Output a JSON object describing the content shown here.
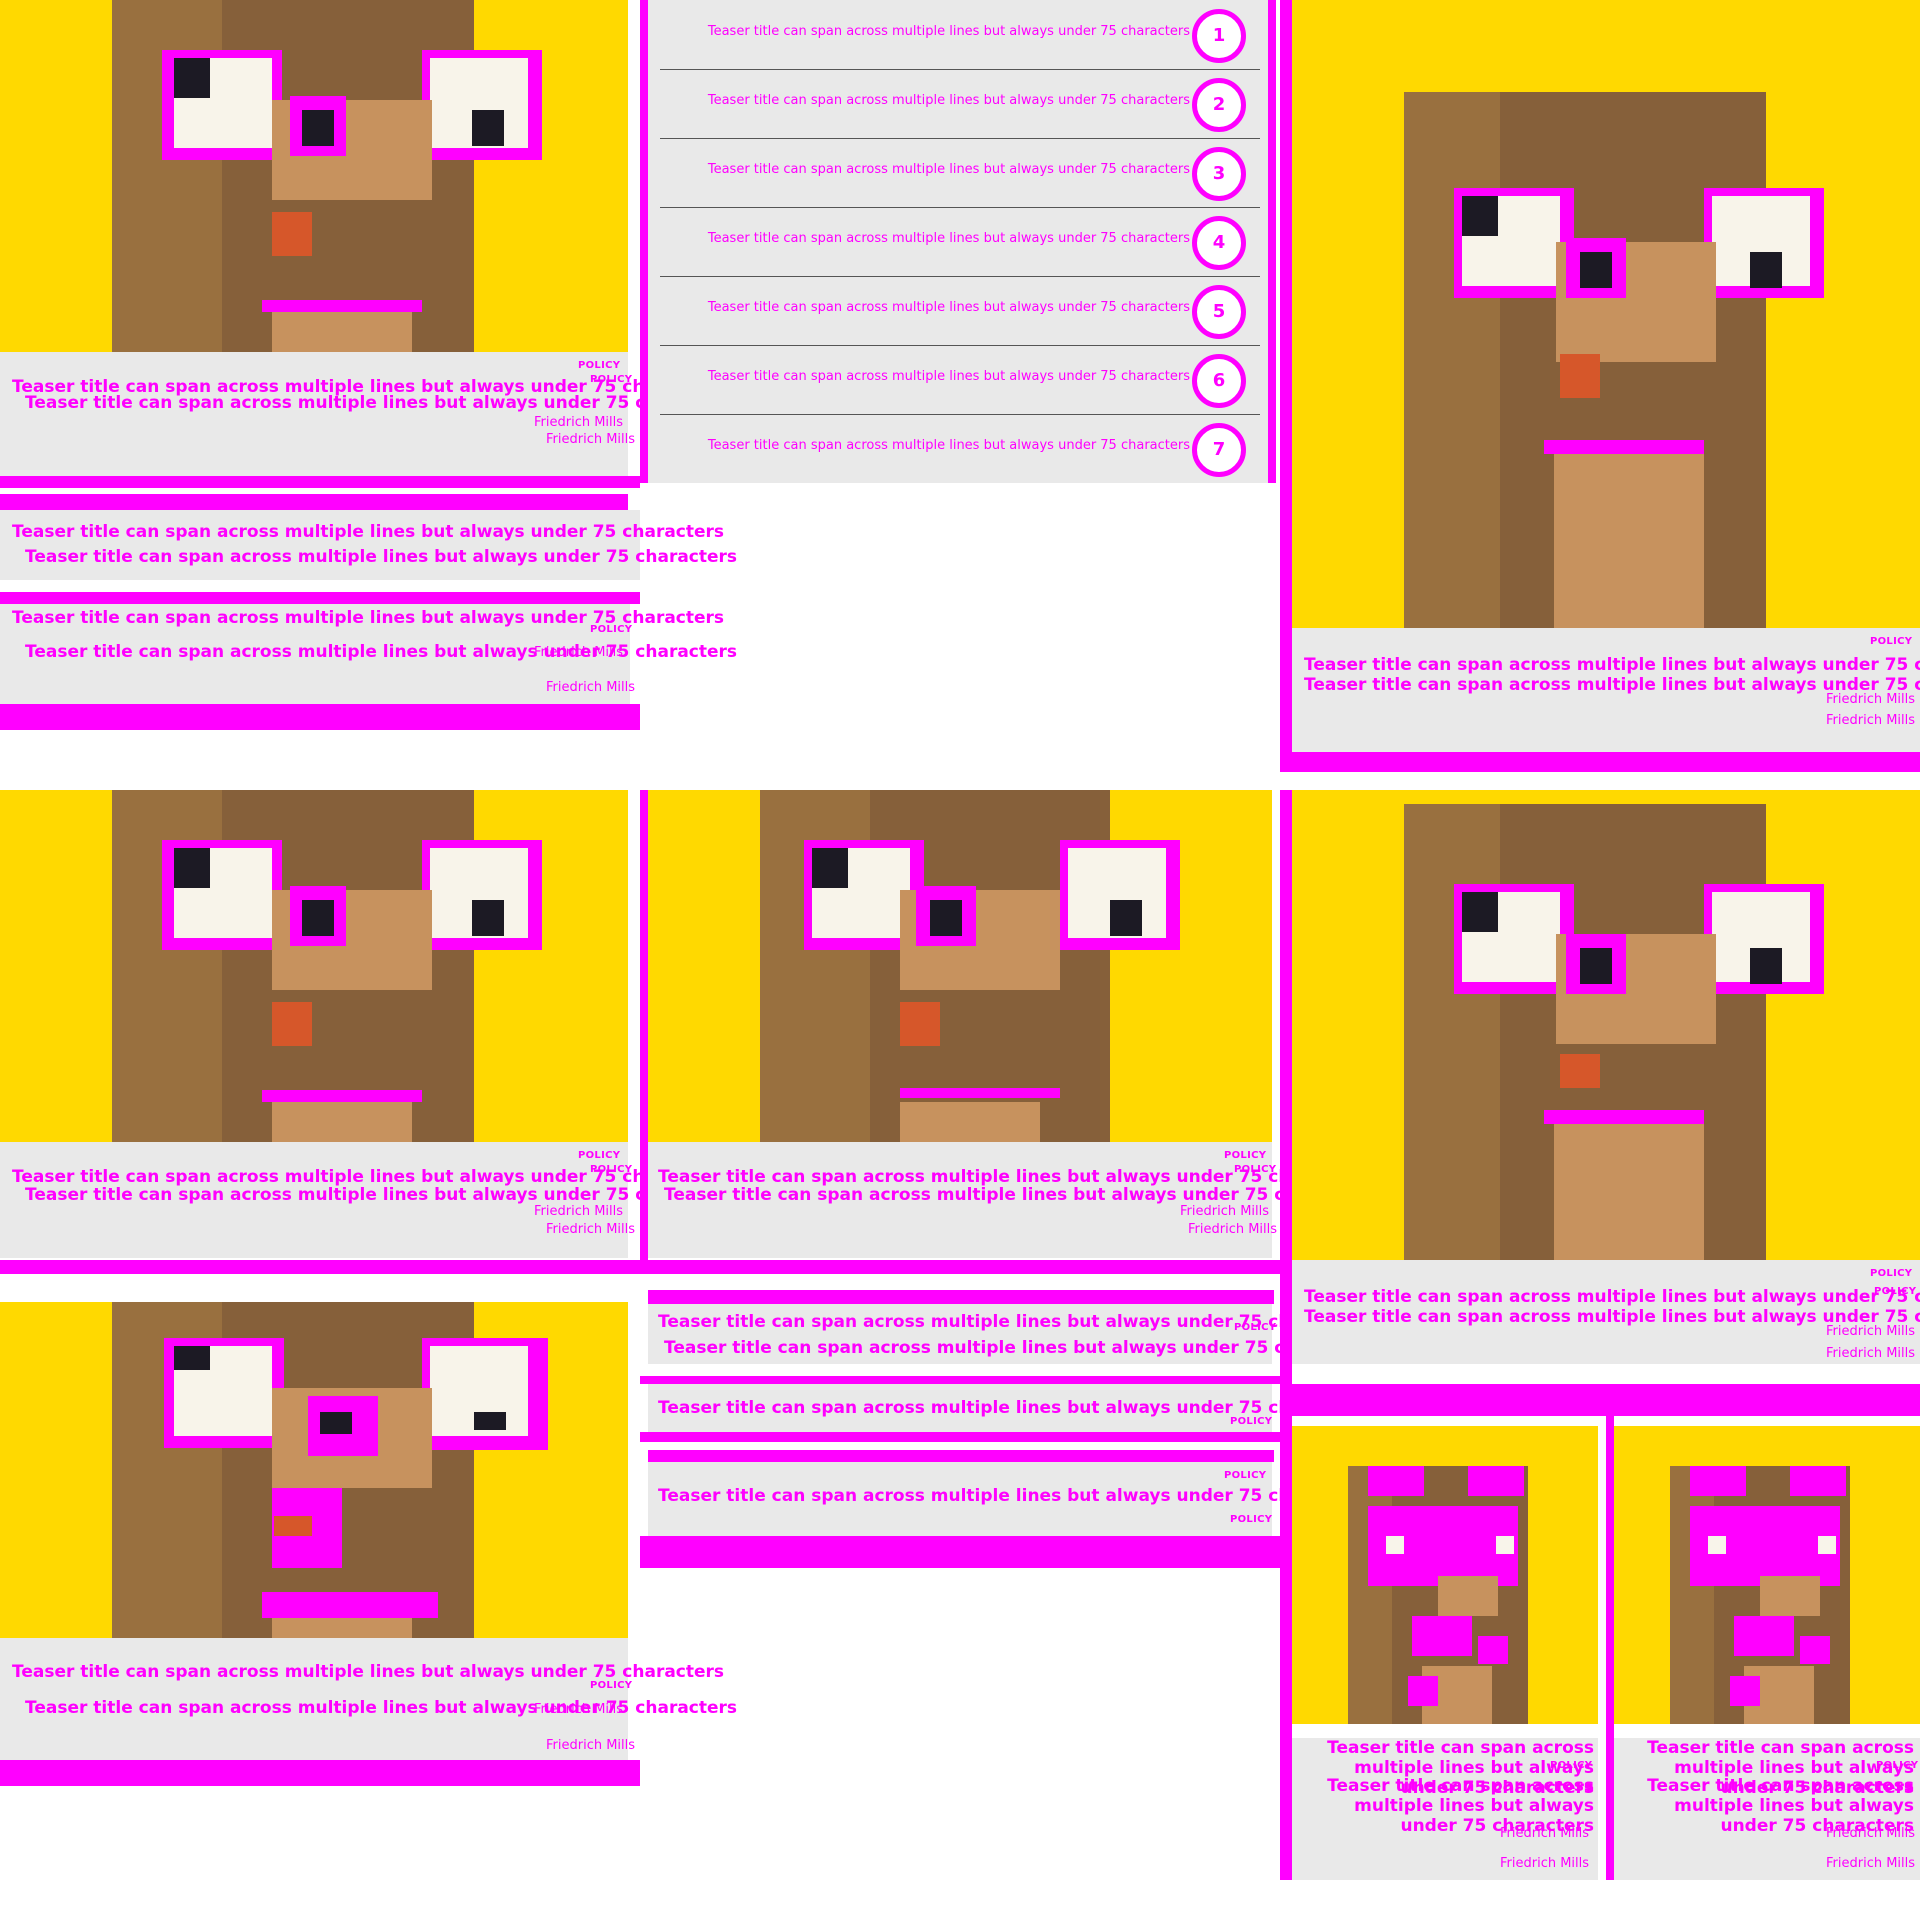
{
  "teaser": {
    "kicker": "POLICY",
    "title": "Teaser title can span across multiple lines but always under 75 characters",
    "author": "Friedrich Mills"
  },
  "list": {
    "items": [
      {
        "title": "Teaser title can span across multiple lines but always under 75 characters",
        "number": "1"
      },
      {
        "title": "Teaser title can span across multiple lines but always under 75 characters",
        "number": "2"
      },
      {
        "title": "Teaser title can span across multiple lines but always under 75 characters",
        "number": "3"
      },
      {
        "title": "Teaser title can span across multiple lines but always under 75 characters",
        "number": "4"
      },
      {
        "title": "Teaser title can span across multiple lines but always under 75 characters",
        "number": "5"
      },
      {
        "title": "Teaser title can span across multiple lines but always under 75 characters",
        "number": "6"
      },
      {
        "title": "Teaser title can span across multiple lines but always under 75 characters",
        "number": "7"
      }
    ]
  },
  "colors": {
    "highlight": "#ff00ff",
    "image_background": "#ffd900",
    "card_background": "#e9e9e9"
  }
}
